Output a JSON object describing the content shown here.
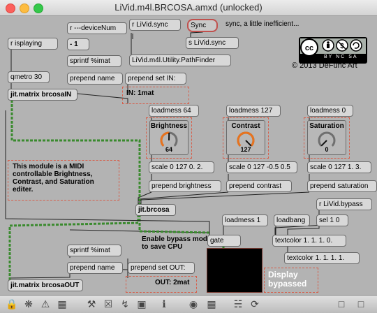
{
  "window": {
    "title": "LiVid.m4l.BRCOSA.amxd (unlocked)"
  },
  "objects": {
    "r_devicenum": "r ---deviceNum",
    "r_isplaying": "r isplaying",
    "minus_one": "- 1",
    "sprintf_top": "sprintf %imat",
    "prepend_name_top": "prepend name",
    "qmetro": "qmetro 30",
    "jit_matrix_in": "jit.matrix brcosaIN",
    "r_livid_sync": "r LiVid.sync",
    "sync_msg": "Sync",
    "s_livid_sync": "s LiVid.sync",
    "pathfinder": "LiVid.m4l.Utility.PathFinder",
    "prepend_set_in": "prepend set IN:",
    "in_msg": "IN: 1mat",
    "loadmess_64": "loadmess 64",
    "loadmess_127": "loadmess 127",
    "loadmess_0": "loadmess 0",
    "scale_brightness": "scale 0 127 0. 2.",
    "scale_contrast": "scale 0 127 -0.5 0.5",
    "scale_saturation": "scale 0 127 1. 3.",
    "prepend_brightness": "prepend brightness",
    "prepend_contrast": "prepend contrast",
    "prepend_saturation": "prepend saturation",
    "jit_brcosa": "jit.brcosa",
    "r_livid_bypass": "r LiVid.bypass",
    "loadmess_1": "loadmess 1",
    "loadbang": "loadbang",
    "sel_10": "sel 1 0",
    "gate": "gate",
    "textcolor_1": "textcolor 1. 1. 1. 0.",
    "textcolor_2": "textcolor 1. 1. 1. 1.",
    "sprintf_bottom": "sprintf %imat",
    "prepend_name_bottom": "prepend name",
    "prepend_set_out": "prepend set OUT:",
    "out_msg": "OUT: 2mat",
    "jit_matrix_out": "jit.matrix brcosaOUT"
  },
  "comments": {
    "sync_note": "sync, a little inefficient...",
    "module_note": "This module is a MIDI controllable Brightness, Contrast, and Saturation editer.",
    "bypass_note": "Enable bypass mode to save CPU",
    "display_bypassed": "Display bypassed",
    "copyright": "© 2013 DeFunc Art"
  },
  "dials": {
    "brightness": {
      "label": "Brightness",
      "value": "64",
      "level": 0.504
    },
    "contrast": {
      "label": "Contrast",
      "value": "127",
      "level": 1.0
    },
    "saturation": {
      "label": "Saturation",
      "value": "0",
      "level": 0.0
    }
  },
  "license_badge": {
    "text": "BY NC SA"
  },
  "colors": {
    "background": "#b3b3b3",
    "object_fill": "#d8d8d8",
    "panel_border": "#d65f4b",
    "dial_arc": "#e8731e",
    "jitter_cord": "#3a8a2e"
  },
  "toolbar_icons": [
    "lock-icon",
    "presentation-icon",
    "warning-icon",
    "grid-icon",
    "tools-icon",
    "close-box-icon",
    "patch-cord-icon",
    "new-object-icon",
    "info-icon",
    "inspector-icon",
    "debug-icon",
    "hierarchy-icon",
    "snap-icon",
    "left-panel-icon",
    "right-panel-icon"
  ]
}
